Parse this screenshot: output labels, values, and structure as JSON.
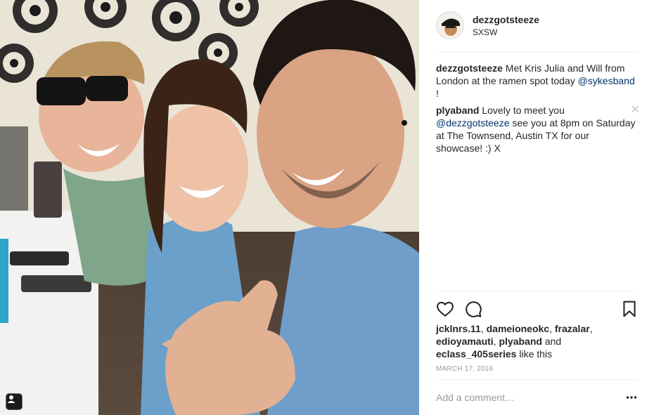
{
  "post": {
    "author": "dezzgotsteeze",
    "location": "SXSW",
    "date": "March 17, 2016"
  },
  "comments": [
    {
      "user": "dezzgotsteeze",
      "text_before": " Met Kris Julia and Will from London at the ramen spot today ",
      "mention": "@sykesband",
      "text_after": " !"
    },
    {
      "user": "plyaband",
      "text_before": " Lovely to meet you ",
      "mention": "@dezzgotsteeze",
      "text_after": " see you at 8pm on Saturday at The Townsend, Austin TX for our showcase! :) X",
      "close_glyph": "✕"
    }
  ],
  "likes": {
    "users": [
      "jcklnrs.11",
      "dameioneokc",
      "frazalar",
      "edioyamauti",
      "plyaband",
      "eclass_405series"
    ],
    "sep1": ", ",
    "sep_and": " and ",
    "suffix": " like this"
  },
  "comment_input": {
    "placeholder": "Add a comment…"
  },
  "icons": {
    "like": "heart-icon",
    "comment": "comment-bubble-icon",
    "save": "bookmark-icon",
    "more": "more-dots-icon",
    "photo_badge": "user-tag-icon"
  }
}
